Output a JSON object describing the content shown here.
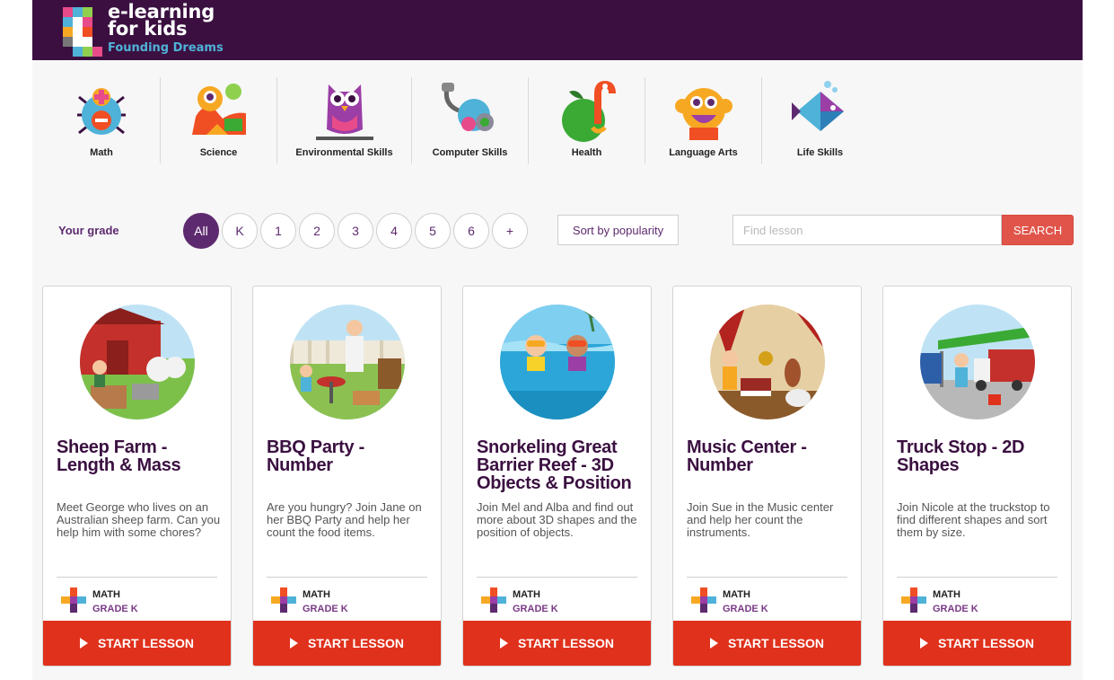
{
  "brand": {
    "title_line1": "e-learning",
    "title_line2": "for kids",
    "tagline": "Founding Dreams"
  },
  "subjects": [
    {
      "label": "Math",
      "icon": "math-spider-icon"
    },
    {
      "label": "Science",
      "icon": "science-chameleon-icon"
    },
    {
      "label": "Environmental Skills",
      "icon": "environmental-owl-icon"
    },
    {
      "label": "Computer Skills",
      "icon": "computer-mouse-icon"
    },
    {
      "label": "Health",
      "icon": "health-apple-worm-icon"
    },
    {
      "label": "Language Arts",
      "icon": "language-monkey-icon"
    },
    {
      "label": "Life Skills",
      "icon": "life-skills-fish-icon"
    }
  ],
  "filter": {
    "grade_label": "Your grade",
    "grades": [
      "All",
      "K",
      "1",
      "2",
      "3",
      "4",
      "5",
      "6",
      "+"
    ],
    "selected_grade": "All",
    "sort_label": "Sort by popularity",
    "search_placeholder": "Find lesson",
    "search_value": "",
    "search_button": "SEARCH"
  },
  "lessons": [
    {
      "title": "Sheep Farm - Length & Mass",
      "description": "Meet George who lives on an Australian sheep farm. Can you help him with some chores?",
      "subject": "MATH",
      "grade": "GRADE K",
      "button": "START LESSON",
      "thumbnail": "sheep-farm-image"
    },
    {
      "title": "BBQ Party - Number",
      "description": "Are you hungry? Join Jane on her BBQ Party and help her count the food items.",
      "subject": "MATH",
      "grade": "GRADE K",
      "button": "START LESSON",
      "thumbnail": "bbq-party-image"
    },
    {
      "title": "Snorkeling Great Barrier Reef - 3D Objects & Position",
      "description": "Join Mel and Alba and find out more about 3D shapes and the position of objects.",
      "subject": "MATH",
      "grade": "GRADE K",
      "button": "START LESSON",
      "thumbnail": "snorkeling-reef-image"
    },
    {
      "title": "Music Center - Number",
      "description": "Join Sue in the Music center and help her count the instruments.",
      "subject": "MATH",
      "grade": "GRADE K",
      "button": "START LESSON",
      "thumbnail": "music-center-image"
    },
    {
      "title": "Truck Stop - 2D Shapes",
      "description": "Join Nicole at the truckstop to find different shapes and sort them by size.",
      "subject": "MATH",
      "grade": "GRADE K",
      "button": "START LESSON",
      "thumbnail": "truck-stop-image"
    }
  ],
  "colors": {
    "header_bg": "#3b1041",
    "accent_purple": "#5e2a6f",
    "start_button": "#e0311c",
    "search_button": "#e0544a"
  }
}
